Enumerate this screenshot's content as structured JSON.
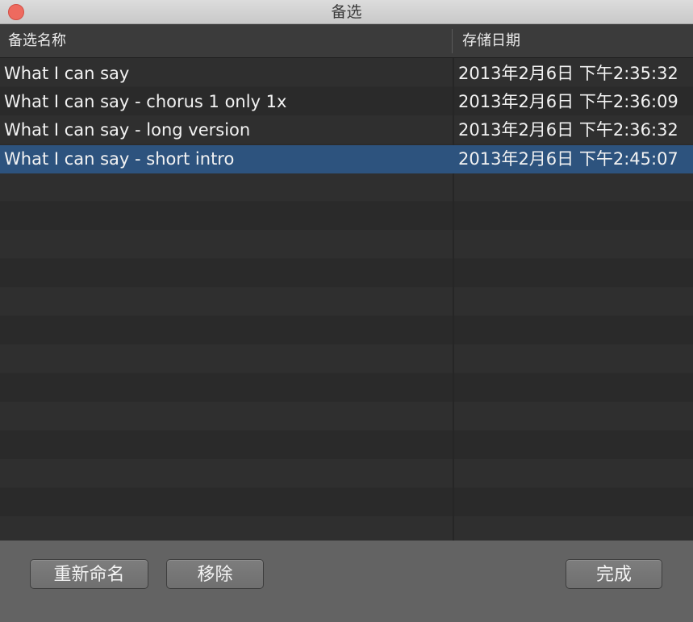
{
  "window": {
    "title": "备选"
  },
  "table": {
    "columns": {
      "name": "备选名称",
      "date": "存储日期"
    },
    "rows": [
      {
        "name": "What I can say",
        "date": "2013年2月6日 下午2:35:32",
        "selected": false
      },
      {
        "name": "What I can say - chorus 1 only 1x",
        "date": "2013年2月6日 下午2:36:09",
        "selected": false
      },
      {
        "name": "What I can say - long version",
        "date": "2013年2月6日 下午2:36:32",
        "selected": false
      },
      {
        "name": "What I can say - short intro",
        "date": "2013年2月6日 下午2:45:07",
        "selected": true
      }
    ]
  },
  "buttons": {
    "rename": "重新命名",
    "remove": "移除",
    "done": "完成"
  },
  "colors": {
    "selection": "#2d537e",
    "close": "#ee6a5f"
  }
}
